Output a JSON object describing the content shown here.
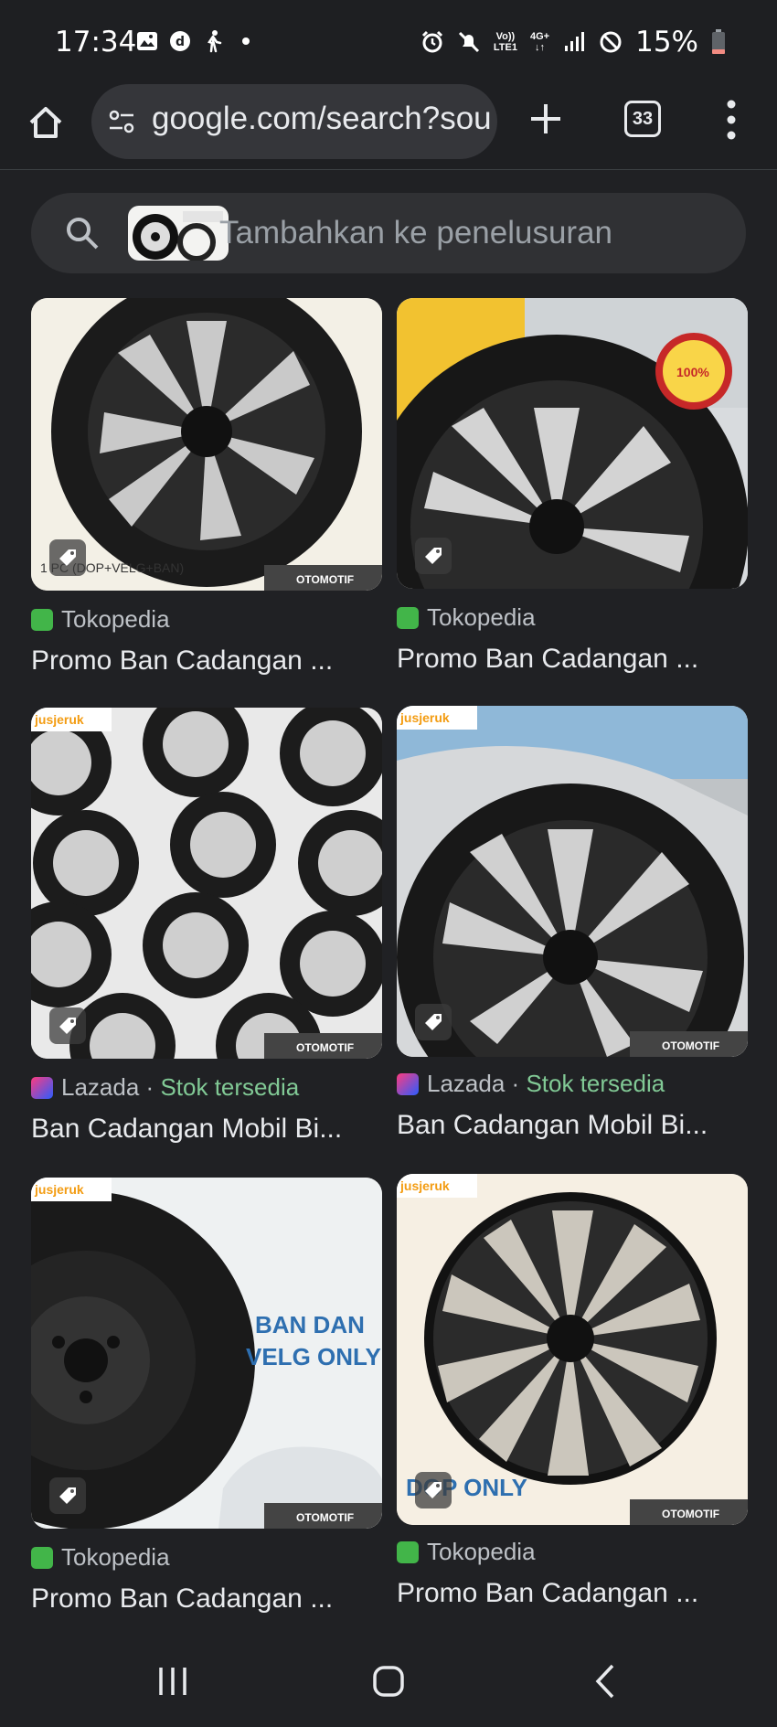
{
  "status_bar": {
    "time": "17:34",
    "network_top": "Vo))",
    "network_bottom": "LTE1",
    "data_label": "4G+",
    "battery": "15%"
  },
  "browser": {
    "url": "google.com/search?sou",
    "tab_count": "33"
  },
  "search": {
    "placeholder": "Tambahkan ke penelusuran"
  },
  "results": [
    {
      "source": "Tokopedia",
      "title": "Promo Ban Cadangan ...",
      "badge": "1 PC (DOP+VELG+BAN)",
      "watermark": "OTOMOTIF"
    },
    {
      "source": "Tokopedia",
      "title": "Promo Ban Cadangan ...",
      "badge": "100%",
      "watermark": ""
    },
    {
      "source": "Lazada",
      "stock": "Stok tersedia",
      "title": "Ban Cadangan Mobil Bi...",
      "badge": "jusjeruk",
      "watermark": "OTOMOTIF"
    },
    {
      "source": "Lazada",
      "stock": "Stok tersedia",
      "title": "Ban Cadangan Mobil Bi...",
      "badge": "jusjeruk",
      "watermark": "OTOMOTIF"
    },
    {
      "source": "Tokopedia",
      "title": "Promo Ban Cadangan ...",
      "badge": "jusjeruk",
      "overlay": "BAN DAN VELG ONLY",
      "watermark": "OTOMOTIF"
    },
    {
      "source": "Tokopedia",
      "title": "Promo Ban Cadangan ...",
      "badge": "jusjeruk",
      "overlay": "DOP ONLY",
      "watermark": "OTOMOTIF"
    }
  ],
  "separator": "·",
  "icons": [
    "home-icon",
    "info-icon",
    "add-icon",
    "tabs-icon",
    "more-icon",
    "search-icon",
    "tag-icon",
    "recents-icon",
    "home-nav-icon",
    "back-icon"
  ]
}
